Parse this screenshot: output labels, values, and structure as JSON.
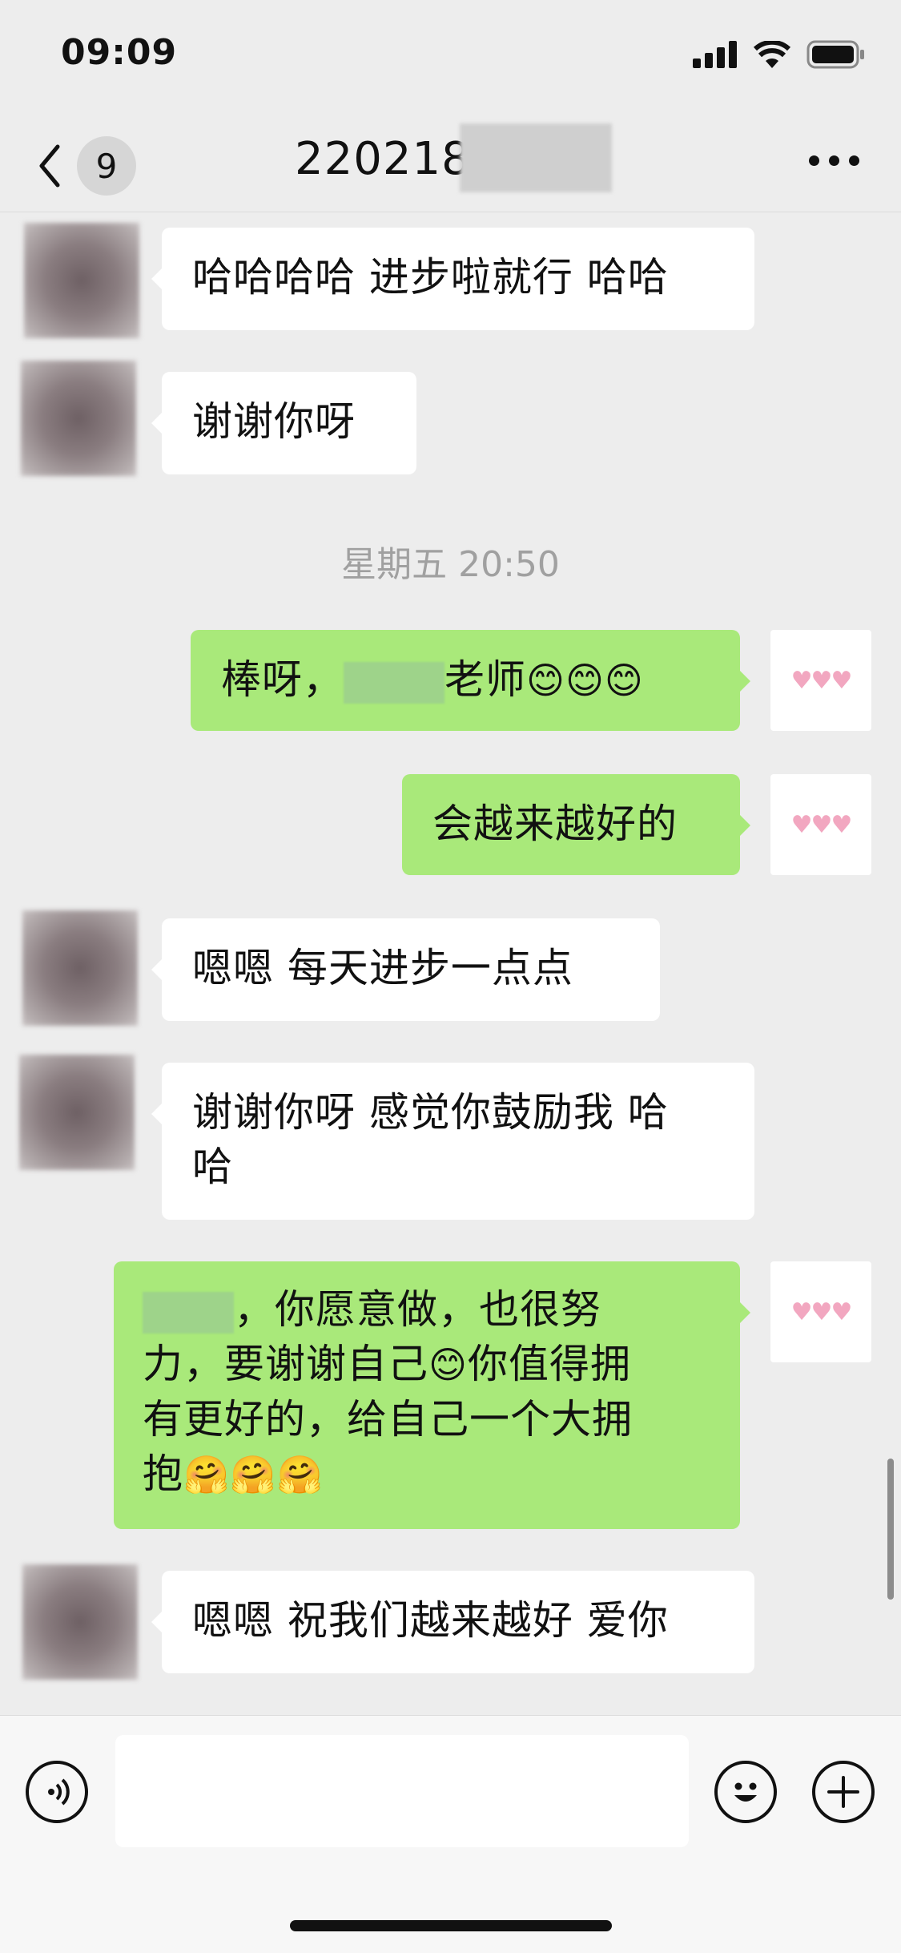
{
  "status_bar": {
    "time": "09:09",
    "icons": [
      "signal-icon",
      "wifi-icon",
      "battery-icon"
    ]
  },
  "nav": {
    "back_icon": "chevron-left-icon",
    "unread_count": "9",
    "title": "220218",
    "more_icon": "more-icon"
  },
  "chat": {
    "timestamp": "星期五 20:50",
    "messages": [
      {
        "from": "other",
        "text": "哈哈哈哈 进步啦就行 哈哈"
      },
      {
        "from": "other",
        "text": "谢谢你呀"
      },
      {
        "from": "me",
        "prefix": "棒呀，",
        "suffix": "老师",
        "emojis": "😊😊😊"
      },
      {
        "from": "me",
        "text": "会越来越好的"
      },
      {
        "from": "other",
        "text": "嗯嗯 每天进步一点点"
      },
      {
        "from": "other",
        "line1": "谢谢你呀 感觉你鼓励我 哈",
        "line2": "哈"
      },
      {
        "from": "me",
        "line1": "，你愿意做，也很努",
        "line2_a": "力，要谢谢自己",
        "emoji": "😊",
        "line2_b": "你值得拥",
        "line3": "有更好的，给自己一个大拥",
        "line4": "抱",
        "hugs": "🤗🤗🤗"
      },
      {
        "from": "other",
        "text": "嗯嗯 祝我们越来越好 爱你"
      }
    ],
    "my_avatar": "♥♥♥"
  },
  "input_bar": {
    "voice_icon": "voice-icon",
    "input_placeholder": "",
    "emoji_icon": "emoji-icon",
    "add_icon": "plus-icon"
  },
  "colors": {
    "background": "#ededed",
    "bubble_out": "#a9e97a",
    "bubble_in": "#ffffff"
  }
}
